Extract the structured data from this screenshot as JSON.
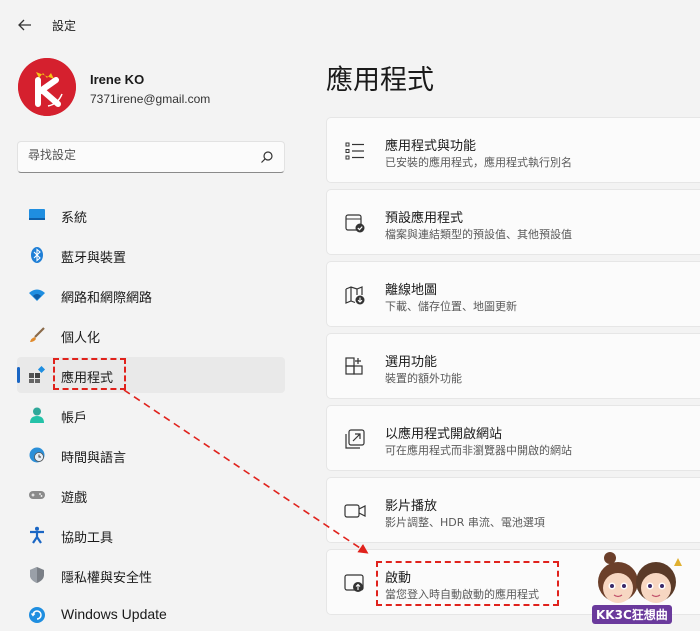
{
  "window": {
    "title": "設定"
  },
  "profile": {
    "name": "Irene KO",
    "email": "7371irene@gmail.com"
  },
  "search": {
    "placeholder": "尋找設定"
  },
  "sidebar": {
    "items": [
      {
        "label": "系統",
        "icon": "display-icon"
      },
      {
        "label": "藍牙與裝置",
        "icon": "bluetooth-icon"
      },
      {
        "label": "網路和網際網路",
        "icon": "wifi-icon"
      },
      {
        "label": "個人化",
        "icon": "brush-icon"
      },
      {
        "label": "應用程式",
        "icon": "apps-icon",
        "selected": true
      },
      {
        "label": "帳戶",
        "icon": "person-icon"
      },
      {
        "label": "時間與語言",
        "icon": "globe-clock-icon"
      },
      {
        "label": "遊戲",
        "icon": "gamepad-icon"
      },
      {
        "label": "協助工具",
        "icon": "accessibility-icon"
      },
      {
        "label": "隱私權與安全性",
        "icon": "shield-icon"
      },
      {
        "label": "Windows Update",
        "icon": "update-icon"
      }
    ]
  },
  "main": {
    "title": "應用程式",
    "cards": [
      {
        "title": "應用程式與功能",
        "desc": "已安裝的應用程式，應用程式執行別名",
        "icon": "list-icon"
      },
      {
        "title": "預設應用程式",
        "desc": "檔案與連結類型的預設值、其他預設值",
        "icon": "default-app-icon"
      },
      {
        "title": "離線地圖",
        "desc": "下載、儲存位置、地圖更新",
        "icon": "map-download-icon"
      },
      {
        "title": "選用功能",
        "desc": "裝置的額外功能",
        "icon": "add-feature-icon"
      },
      {
        "title": "以應用程式開啟網站",
        "desc": "可在應用程式而非瀏覽器中開啟的網站",
        "icon": "open-link-icon"
      },
      {
        "title": "影片播放",
        "desc": "影片調整、HDR 串流、電池選項",
        "icon": "video-icon"
      },
      {
        "title": "啟動",
        "desc": "當您登入時自動啟動的應用程式",
        "icon": "startup-icon"
      }
    ]
  },
  "colors": {
    "accent": "#1a66c4",
    "annotation": "#e0221c"
  },
  "watermark": {
    "text": "KK3C狂想曲"
  }
}
